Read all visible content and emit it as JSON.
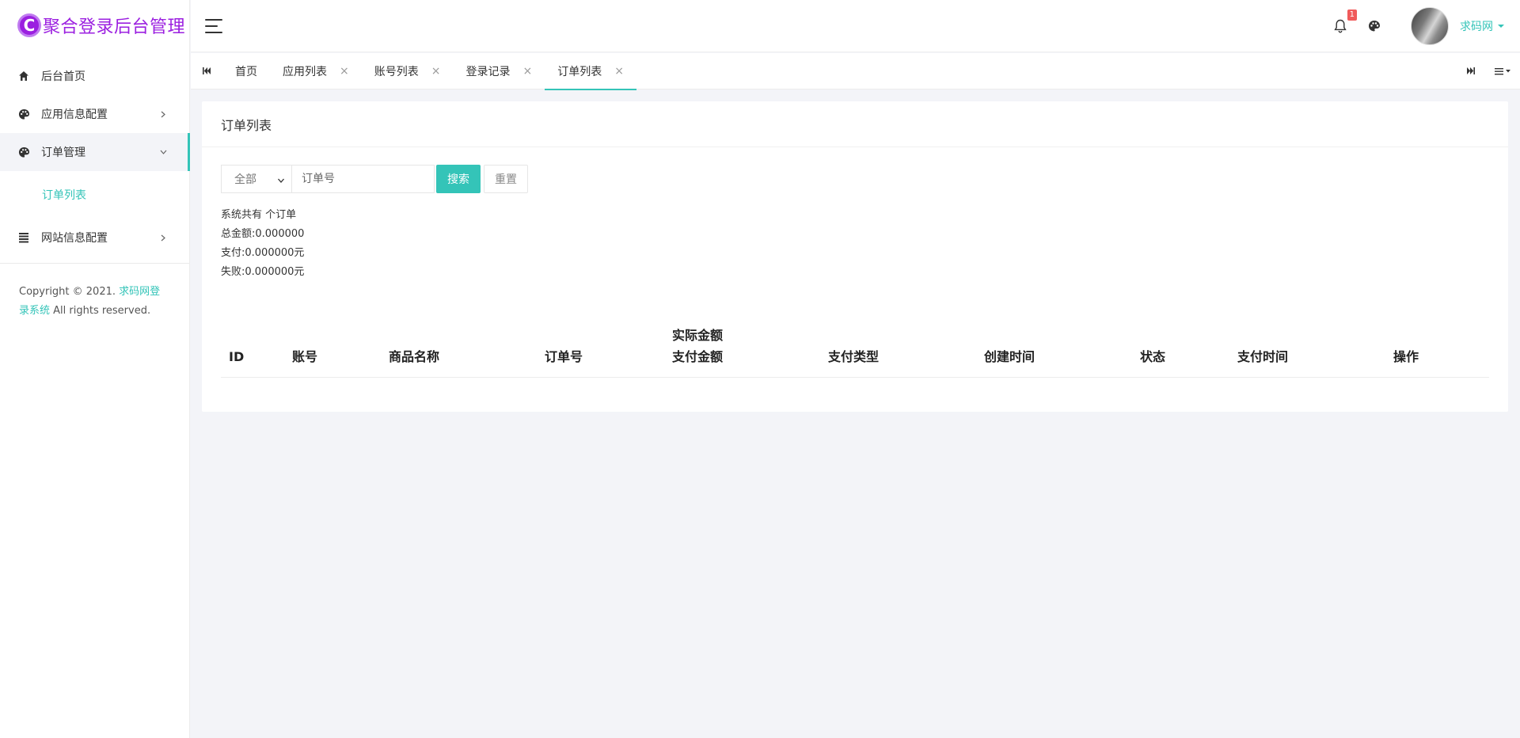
{
  "brand": {
    "logo_letter": "C",
    "title": "聚合登录后台管理"
  },
  "sidebar": {
    "items": [
      {
        "label": "后台首页",
        "icon": "home-icon"
      },
      {
        "label": "应用信息配置",
        "icon": "palette-icon"
      },
      {
        "label": "订单管理",
        "icon": "palette-icon"
      },
      {
        "label": "网站信息配置",
        "icon": "list-icon"
      }
    ],
    "sub_items": [
      {
        "label": "订单列表"
      }
    ],
    "copyright_prefix": "Copyright © 2021.",
    "copyright_link": "求码网登录系统",
    "copyright_suffix": "All rights reserved."
  },
  "header": {
    "notification_count": "1",
    "user_name": "求码网"
  },
  "tabs": [
    {
      "label": "首页",
      "closable": false
    },
    {
      "label": "应用列表",
      "closable": true
    },
    {
      "label": "账号列表",
      "closable": true
    },
    {
      "label": "登录记录",
      "closable": true
    },
    {
      "label": "订单列表",
      "closable": true,
      "active": true
    }
  ],
  "tab_close_glyph": "×",
  "card": {
    "title": "订单列表",
    "filter_select": "全部",
    "order_placeholder": "订单号",
    "search_button": "搜索",
    "reset_button": "重置",
    "stats": {
      "total_orders": "系统共有 个订单",
      "total_amount": "总金额:0.000000",
      "paid": "支付:0.000000元",
      "failed": "失败:0.000000元"
    }
  },
  "table": {
    "columns": [
      {
        "label": "ID"
      },
      {
        "label": "账号"
      },
      {
        "label": "商品名称"
      },
      {
        "label": "订单号"
      },
      {
        "label": "实际金额",
        "label2": "支付金额"
      },
      {
        "label": "支付类型"
      },
      {
        "label": "创建时间"
      },
      {
        "label": "状态"
      },
      {
        "label": "支付时间"
      },
      {
        "label": "操作"
      }
    ]
  },
  "colors": {
    "accent": "#34c4b8",
    "brand": "#9b1fe0",
    "badge": "#f05a5a"
  }
}
